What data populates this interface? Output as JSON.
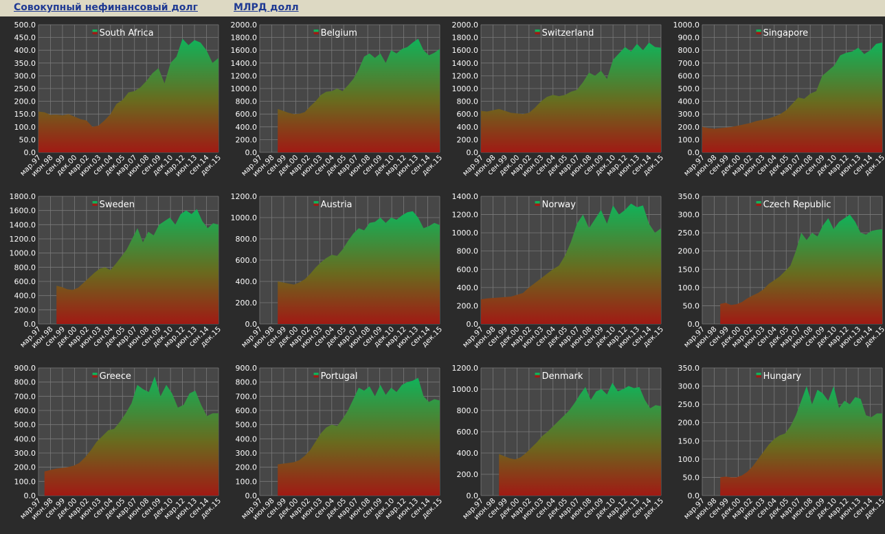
{
  "header": {
    "title": "Совокупный нефинансовый долг",
    "unit": "МЛРД долл"
  },
  "colors": {
    "header_bg": "#ddd9c3",
    "header_text": "#1f3a93",
    "page_bg": "#2b2b2b",
    "plot_bg": "#474747",
    "grid": "#7a7a7a",
    "fill_top": "#10b35a",
    "fill_bottom": "#a01a14",
    "text": "#ffffff"
  },
  "xcategories": [
    "мар.97",
    "июн.98",
    "сен.99",
    "дек.00",
    "мар.02",
    "июн.03",
    "сен.04",
    "дек.05",
    "мар.07",
    "июн.08",
    "сен.09",
    "дек.10",
    "мар.12",
    "июн.13",
    "сен.14",
    "дек.15"
  ],
  "chart_data": [
    {
      "type": "area",
      "legend": "South Africa",
      "ylim": [
        0,
        500
      ],
      "ystep": 50,
      "start": 0,
      "values": [
        160,
        157,
        147,
        148,
        145,
        150,
        140,
        130,
        125,
        100,
        105,
        125,
        150,
        190,
        205,
        235,
        240,
        255,
        280,
        310,
        330,
        270,
        350,
        375,
        445,
        420,
        440,
        430,
        400,
        350,
        370
      ]
    },
    {
      "type": "area",
      "legend": "Belgium",
      "ylim": [
        0,
        2000
      ],
      "ystep": 200,
      "start": 1.5,
      "values": [
        680,
        650,
        620,
        600,
        605,
        630,
        720,
        800,
        900,
        950,
        960,
        1000,
        960,
        1050,
        1150,
        1300,
        1500,
        1550,
        1480,
        1550,
        1400,
        1600,
        1550,
        1620,
        1650,
        1720,
        1780,
        1600,
        1520,
        1560,
        1620
      ]
    },
    {
      "type": "area",
      "legend": "Switzerland",
      "ylim": [
        0,
        2000
      ],
      "ystep": 200,
      "start": 0,
      "values": [
        650,
        640,
        660,
        680,
        650,
        620,
        610,
        600,
        620,
        700,
        800,
        870,
        900,
        880,
        900,
        950,
        980,
        1100,
        1250,
        1200,
        1280,
        1150,
        1450,
        1550,
        1650,
        1580,
        1700,
        1600,
        1720,
        1650,
        1640
      ]
    },
    {
      "type": "area",
      "legend": "Singapore",
      "ylim": [
        0,
        1000
      ],
      "ystep": 100,
      "start": 0,
      "values": [
        200,
        190,
        185,
        190,
        195,
        200,
        210,
        220,
        230,
        245,
        255,
        265,
        280,
        300,
        330,
        380,
        430,
        420,
        460,
        480,
        600,
        640,
        680,
        760,
        780,
        790,
        820,
        770,
        800,
        850,
        860
      ]
    },
    {
      "type": "area",
      "legend": "Sweden",
      "ylim": [
        0,
        1800
      ],
      "ystep": 200,
      "start": 1.5,
      "values": [
        540,
        520,
        490,
        480,
        510,
        580,
        650,
        720,
        780,
        800,
        760,
        850,
        950,
        1050,
        1200,
        1350,
        1150,
        1300,
        1250,
        1400,
        1450,
        1500,
        1400,
        1550,
        1600,
        1550,
        1620,
        1450,
        1350,
        1420,
        1400
      ]
    },
    {
      "type": "area",
      "legend": "Austria",
      "ylim": [
        0,
        1200
      ],
      "ystep": 200,
      "start": 1.5,
      "values": [
        400,
        390,
        380,
        370,
        390,
        420,
        470,
        530,
        580,
        620,
        650,
        640,
        700,
        780,
        850,
        900,
        880,
        950,
        960,
        1000,
        950,
        1000,
        980,
        1020,
        1050,
        1060,
        1000,
        900,
        920,
        950,
        930
      ]
    },
    {
      "type": "area",
      "legend": "Norway",
      "ylim": [
        0,
        1400
      ],
      "ystep": 200,
      "start": 0,
      "values": [
        270,
        280,
        285,
        290,
        295,
        300,
        320,
        340,
        400,
        450,
        500,
        550,
        600,
        640,
        750,
        900,
        1100,
        1200,
        1050,
        1150,
        1250,
        1100,
        1300,
        1200,
        1250,
        1320,
        1280,
        1300,
        1100,
        1000,
        1050
      ]
    },
    {
      "type": "area",
      "legend": "Czech Republic",
      "ylim": [
        0,
        350
      ],
      "ystep": 50,
      "start": 1.5,
      "values": [
        55,
        58,
        52,
        54,
        60,
        70,
        78,
        85,
        95,
        110,
        120,
        130,
        145,
        160,
        200,
        250,
        230,
        250,
        240,
        270,
        290,
        260,
        280,
        290,
        300,
        280,
        250,
        245,
        255,
        258,
        260
      ]
    },
    {
      "type": "area",
      "legend": "Greece",
      "ylim": [
        0,
        900
      ],
      "ystep": 100,
      "start": 0.5,
      "values": [
        170,
        180,
        190,
        195,
        200,
        210,
        230,
        270,
        320,
        380,
        420,
        460,
        470,
        520,
        580,
        650,
        780,
        750,
        730,
        840,
        700,
        780,
        720,
        620,
        640,
        720,
        740,
        640,
        560,
        580,
        580
      ]
    },
    {
      "type": "area",
      "legend": "Portugal",
      "ylim": [
        0,
        900
      ],
      "ystep": 100,
      "start": 1.5,
      "values": [
        220,
        225,
        230,
        235,
        250,
        280,
        320,
        380,
        440,
        480,
        500,
        490,
        540,
        600,
        680,
        760,
        740,
        770,
        700,
        780,
        710,
        760,
        730,
        780,
        800,
        810,
        830,
        700,
        660,
        680,
        670
      ]
    },
    {
      "type": "area",
      "legend": "Denmark",
      "ylim": [
        0,
        1200
      ],
      "ystep": 200,
      "start": 1.5,
      "values": [
        390,
        370,
        350,
        340,
        360,
        400,
        450,
        500,
        560,
        600,
        650,
        700,
        750,
        800,
        870,
        950,
        1020,
        900,
        980,
        1000,
        950,
        1060,
        980,
        1000,
        1030,
        1010,
        1020,
        900,
        820,
        850,
        840
      ]
    },
    {
      "type": "area",
      "legend": "Hungary",
      "ylim": [
        0,
        350
      ],
      "ystep": 50,
      "start": 1.5,
      "values": [
        50,
        52,
        50,
        50,
        55,
        65,
        80,
        100,
        120,
        140,
        155,
        165,
        170,
        190,
        220,
        260,
        300,
        250,
        290,
        280,
        260,
        300,
        240,
        260,
        250,
        270,
        265,
        220,
        215,
        225,
        225
      ]
    }
  ]
}
